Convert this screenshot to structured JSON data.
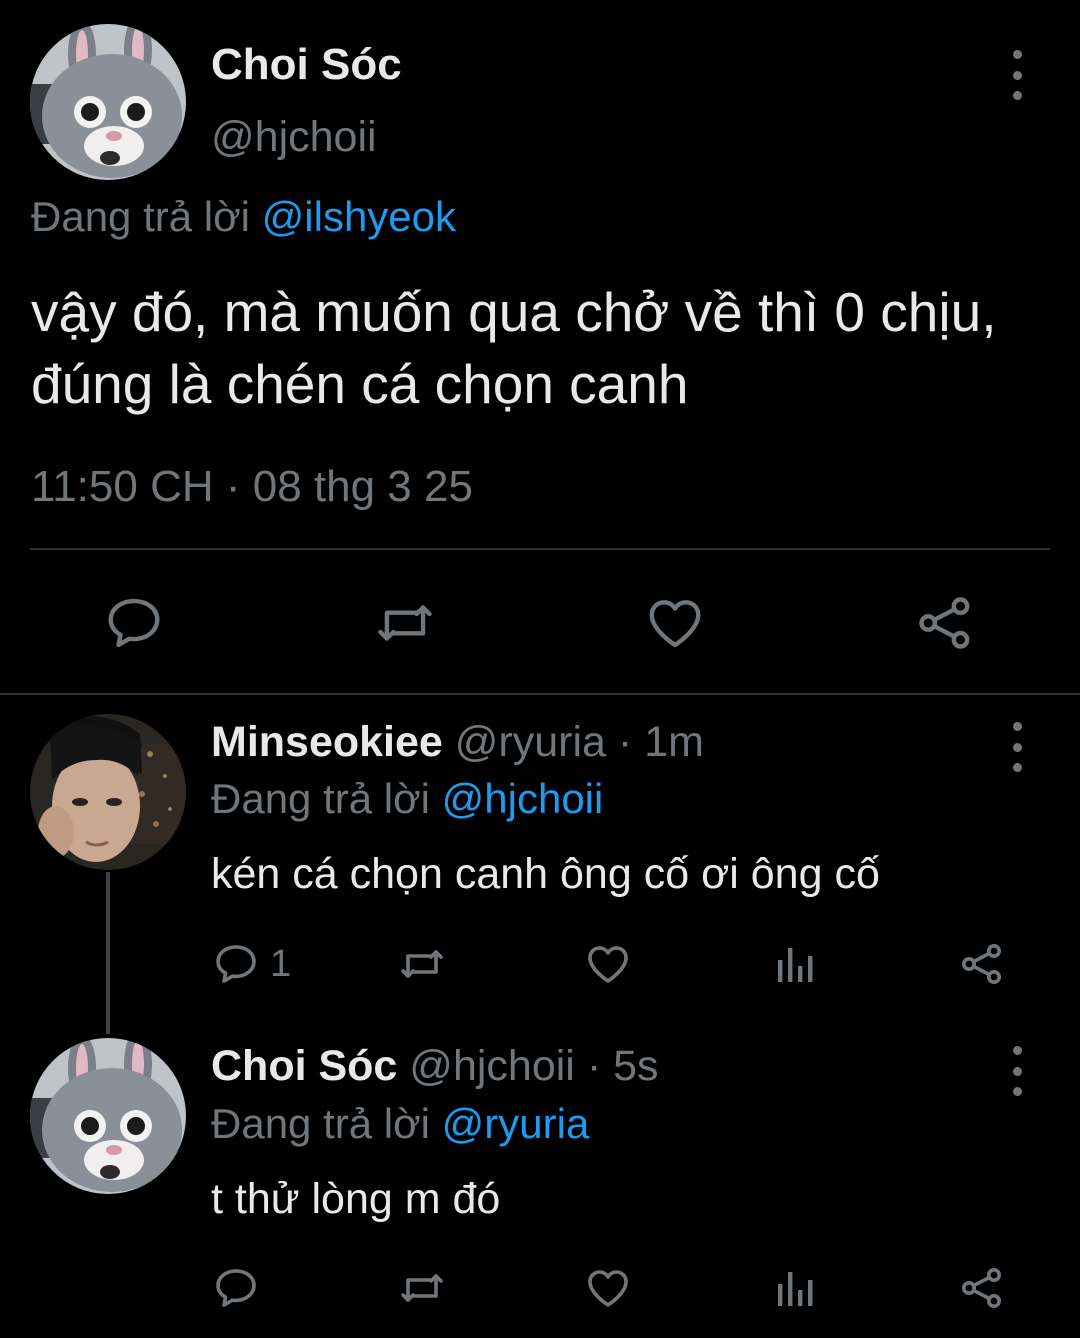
{
  "main_tweet": {
    "author_name": "Choi Sóc",
    "author_handle": "@hjchoii",
    "replying_prefix": "Đang trả lời",
    "replying_to": "@ilshyeok",
    "text": "vậy đó, mà muốn qua chở về thì 0 chịu, đúng là chén cá chọn canh",
    "timestamp": "11:50 CH · 08 thg 3 25",
    "actions": [
      "reply-icon",
      "retweet-icon",
      "like-icon",
      "share-icon"
    ]
  },
  "replies": [
    {
      "author_name": "Minseokiee",
      "author_handle": "@ryuria",
      "separator": "·",
      "time": "1m",
      "replying_prefix": "Đang trả lời",
      "replying_to": "@hjchoii",
      "text": "kén cá chọn canh ông cố ơi ông cố",
      "reply_count": "1"
    },
    {
      "author_name": "Choi Sóc",
      "author_handle": "@hjchoii",
      "separator": "·",
      "time": "5s",
      "replying_prefix": "Đang trả lời",
      "replying_to": "@ryuria",
      "text": "t thử lòng m đó",
      "reply_count": ""
    }
  ],
  "colors": {
    "background": "#000000",
    "text_primary": "#e7e9ea",
    "text_secondary": "#71767b",
    "accent": "#1d9bf0",
    "divider": "#2f3336"
  }
}
